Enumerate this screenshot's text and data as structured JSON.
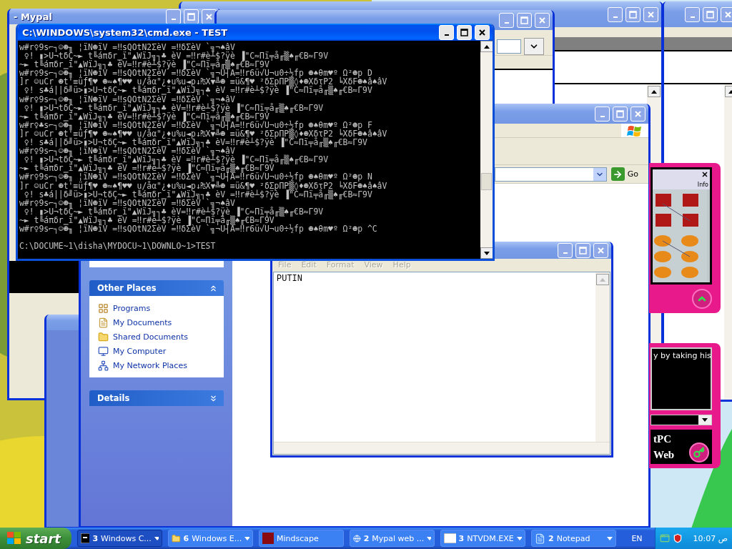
{
  "left_window": {
    "title": "- Mypal",
    "active": false
  },
  "browser_window": {
    "active": false
  },
  "mypal_window": {
    "active": false
  },
  "right_window": {
    "active": false
  },
  "back_explorer": {
    "active": false
  },
  "explorer": {
    "active": false,
    "go": "Go",
    "other_places": {
      "title": "Other Places",
      "expanded": true,
      "items": [
        {
          "label": "Programs",
          "kind": "programs"
        },
        {
          "label": "My Documents",
          "kind": "documents"
        },
        {
          "label": "Shared Documents",
          "kind": "folder"
        },
        {
          "label": "My Computer",
          "kind": "computer"
        },
        {
          "label": "My Network Places",
          "kind": "network"
        }
      ]
    },
    "details": {
      "title": "Details",
      "expanded": false
    }
  },
  "notepad": {
    "active": false,
    "menu": [
      {
        "label": "File",
        "disabled": true
      },
      {
        "label": "Edit",
        "disabled": true
      },
      {
        "label": "Format",
        "disabled": true
      },
      {
        "label": "View",
        "disabled": true
      },
      {
        "label": "Help",
        "disabled": true
      }
    ],
    "text": "PUTIN"
  },
  "pink_app": {
    "info": "Info",
    "message": "y by taking his",
    "brand_line_1": "tPC",
    "brand_line_2": "Web"
  },
  "cmd": {
    "title": "C:\\WINDOWS\\system32\\cmd.exe - TEST",
    "active": true,
    "lines": [
      "w#r♀9s⌐┐☺☻╖ ¦ïN☻ïV =‼sQOtN2ΣèV =‼δΣèV `╗¬♠âV",
      " ♀! ▮>U¬tδÇ~► t╚áπδr‗ï\"▲WïJ╗┐♣ èV =‼r#è┴$?ÿè ▐\"C≈Πï╤å╓▒♠╓€B≈Γ9V",
      "~► t╚áπδr‗ï\"▲WïJ╗┐♣ èV=‼r#è┴$?ÿè ▐\"C≈Πï╤å╓▒♠╓€B≈Γ9V",
      "w#r♀9s⌐┐☺☻╖ ¦ïN☻ïV =‼sQOtN2ΣèV =‼δΣèV `╗¬U┤A=‼r6ü√U¬u0÷½fp ☻♠θm♥º Ω²☻p D",
      "]r ☺uCr ☻t'≡üƒ¶♥ ☻≈♠¶♥♥ u/åα\"¿♦u%u◄p↓₧X▼╩☻ ≡ü&¶♥ ²δΣpΠP▒◊♦☻XδτP2 ╘XδF☻♠â♠âV",
      " ♀! s♣á||δ╝ü>▮>U¬tδÇ~► t╚áπδr‗ï\"▲WïJ╗┐♣ èV =‼r#è┴$?ÿè ▐\"C≈Πï╤å╓▒♠╓€B≈Γ9V",
      "w#r♀9s⌐┐☺☻╖ ¦ïN☻ïV =‼sQOtN2ΣèV =‼δΣèV `╗¬♠âV",
      " ♀! ▮>U¬tδÇ~► t╚áπδr‗ï\"▲WïJ╗┐♣ èV=‼r#è┴$?ÿè ▐\"C≈Πï╤å╓▒♠╓€B≈Γ9V",
      "~► t╚áπδr‗ï\"▲WïJ╗┐♣ èV=‼r#è┴$?ÿè ▐\"C≈Πï╤å╓▒♠╓€B≈Γ9V",
      "w#r♀♣s⌐┐☺☻╖ ¦ïN☻ïV =‼sQOtN2ΣèV =‼δΣèV `╗¬U┤A=‼r6ü√U¬u0÷½fp ☻♠θm♥º Ω²☻p F",
      "]r ☺uCr ☻t'≡üƒ¶♥ ☻≈♠¶♥♥ u/åα\"¿♦u%u◄p↓₧X▼╩☻ ≡ü&¶♥ ²δΣpΠP▒◊♦☻XδτP2 ╘XδF☻♠â♠âV",
      " ♀! s♣á||δ╝ü>▮>U¬tδÇ~► t╚áπδr‗ï\"▲WïJ╗┐♣ èV=‼r#è┴$?ÿè ▐\"C≈Πï╤å╓▒♠╓€B≈Γ9V",
      "w#r♀9s⌐┐☺☻╖ ¦ïN☻ïV =‼sQOtN2ΣèV =‼δΣèV `╗¬♠âV",
      " ♀! ▮>U¬tδÇ~► t╚áπδr‗ï\"▲WïJ╗┐♣ èV =‼r#è┴$?ÿè ▐\"C≈Πï╤å╓▒♠╓€B≈Γ9V",
      "~► t╚áπδr‗ï\"▲WïJ╗┐♣ èV =‼r#è┴$?ÿè ▐\"C≈Πï╤å╓▒♠╓€B≈Γ9V",
      "w#r♀9s⌐┐☺☻╖ ¦ïN☻ïV =‼sQOtN2ΣèV =‼δΣèV `╗¬U┤A=‼r6ü√U¬u0÷½fp ☻♠θm♥º Ω²☻p N",
      "]r ☺uCr ☻t'≡üƒ¶♥ ☻≈♠¶♥♥ u/åα\"¿♦u%u◄p↓₧X▼╩☻ ≡ü&¶♥ ²δΣpΠP▒◊♦☻XδτP2 ╘XδF☻♠â♠âV",
      " ♀! s♣á||δ╝ü>▮>U¬tδÇ~► t╚áπδr‗ï\"▲WïJ╗┐♣ èV =‼r#è┴$?ÿè ▐\"C≈Πï╤å╓▒♠╓€B≈Γ9V",
      "w#r♀9s⌐┐☺☻╖ ¦ïN☻ïV =‼sQOtN2ΣèV =‼δΣèV `╗¬♠âV",
      " ♀! ▮>U¬tδÇ~► t╚áπδr‗ï\"▲WïJ╗┐♣ èV=‼r#è┴$?ÿè ▐\"C≈Πï╤å╓▒♠╓€B≈Γ9V",
      "~► t╚áπδr‗ï\"▲WïJ╗┐♣ èV =‼r#è┴$?ÿè ▐\"C≈Πï╤å╓▒♠╓€B≈Γ9V",
      "w#r♀9s⌐┐☺☻╖ ¦ïN☻ïV =‼sQOtN2ΣèV =‼δΣèV `╗¬U┤A=‼r6ü√U¬u0÷½fp ☻♠θm♥º Ω²☻p ^C"
    ],
    "prompt": "C:\\DOCUME~1\\disha\\MYDOCU~1\\DOWNLO~1>TEST"
  },
  "taskbar": {
    "start": "start",
    "tasks": [
      {
        "count": "3",
        "label": "Windows C...",
        "kind": "cmd",
        "grouped": true,
        "selected": true
      },
      {
        "count": "6",
        "label": "Windows E...",
        "kind": "folder",
        "grouped": true,
        "selected": false
      },
      {
        "label": "Mindscape",
        "kind": "app",
        "grouped": false,
        "selected": false
      },
      {
        "count": "2",
        "label": "Mypal web ...",
        "kind": "browser",
        "grouped": true,
        "selected": false
      },
      {
        "count": "3",
        "label": "NTVDM.EXE",
        "kind": "window",
        "grouped": true,
        "selected": false
      },
      {
        "count": "2",
        "label": "Notepad",
        "kind": "notepad",
        "grouped": true,
        "selected": false
      }
    ],
    "language": "EN",
    "clock": "10:07 ص"
  }
}
